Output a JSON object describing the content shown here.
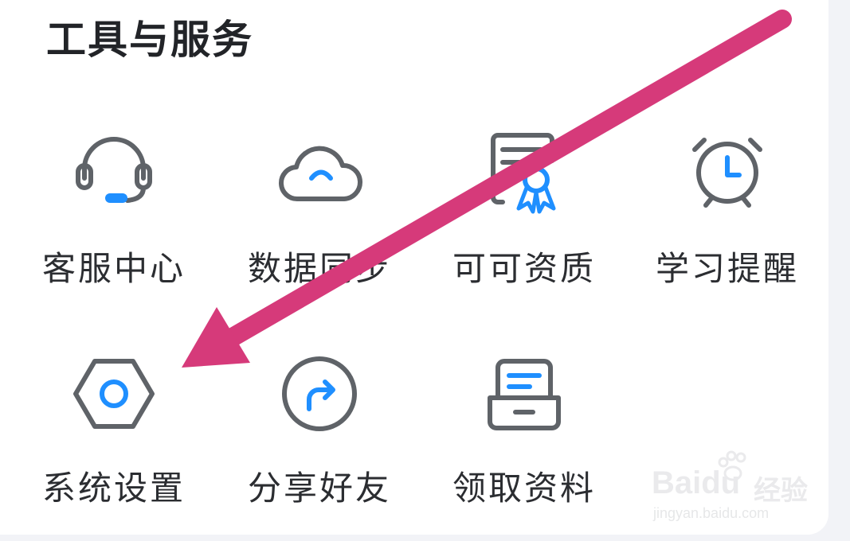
{
  "section": {
    "title": "工具与服务"
  },
  "items": [
    {
      "label": "客服中心",
      "icon": "headset-icon"
    },
    {
      "label": "数据同步",
      "icon": "cloud-sync-icon"
    },
    {
      "label": "可可资质",
      "icon": "certificate-icon"
    },
    {
      "label": "学习提醒",
      "icon": "alarm-clock-icon"
    },
    {
      "label": "系统设置",
      "icon": "settings-hex-icon"
    },
    {
      "label": "分享好友",
      "icon": "share-icon"
    },
    {
      "label": "领取资料",
      "icon": "inbox-tray-icon"
    }
  ],
  "annotation": {
    "arrow_color": "#d63a7a",
    "points_to": "系统设置"
  },
  "colors": {
    "icon_gray": "#5f6368",
    "accent_blue": "#1f8fff"
  },
  "watermark": {
    "logo": "Bai",
    "logo_tail": "du",
    "brand": "经验",
    "url": "jingyan.baidu.com"
  }
}
